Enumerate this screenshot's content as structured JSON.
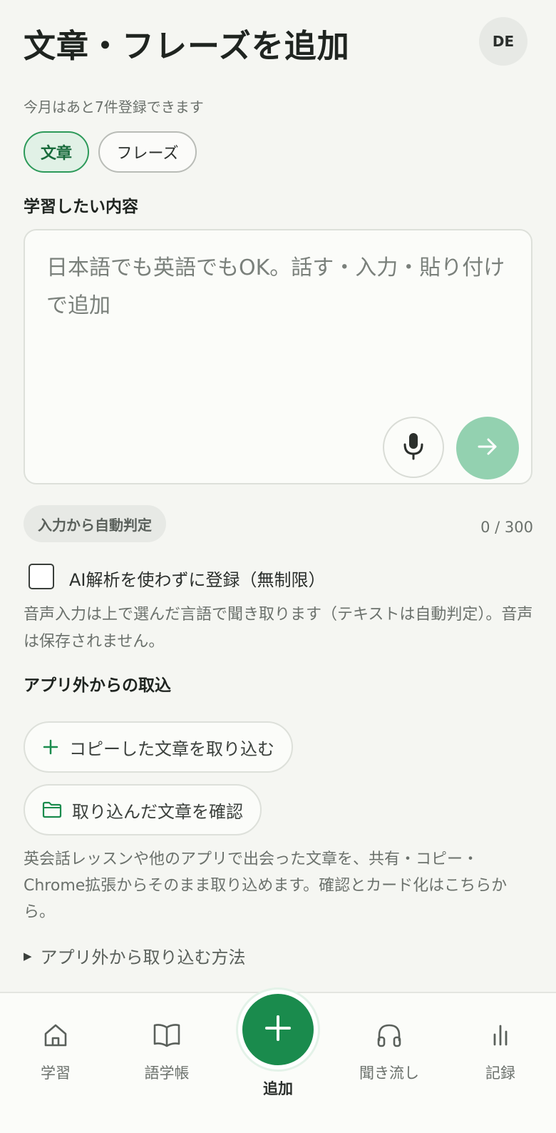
{
  "header": {
    "title": "文章・フレーズを追加",
    "avatar_initials": "DE"
  },
  "quota_text": "今月はあと7件登録できます",
  "type_chips": [
    {
      "label": "文章",
      "selected": true
    },
    {
      "label": "フレーズ",
      "selected": false
    }
  ],
  "content_section": {
    "label": "学習したい内容",
    "placeholder": "日本語でも英語でもOK。話す・入力・貼り付けで追加",
    "value": "",
    "mic_icon": "mic-icon",
    "send_icon": "arrow-right-icon"
  },
  "language_badge": "入力から自動判定",
  "char_counter": "0 / 300",
  "no_ai_option": {
    "label": "AI解析を使わずに登録（無制限）",
    "checked": false
  },
  "voice_note": "音声入力は上で選んだ言語で聞き取ります（テキストは自動判定）。音声は保存されません。",
  "import_section": {
    "title": "アプリ外からの取込",
    "import_button": "コピーした文章を取り込む",
    "review_button": "取り込んだ文章を確認",
    "description": "英会話レッスンや他のアプリで出会った文章を、共有・コピー・Chrome拡張からそのまま取り込めます。確認とカード化はこちらから。",
    "howto_label": "アプリ外から取り込む方法"
  },
  "colors": {
    "accent": "#1a8b4d",
    "accent_light": "#93d1b0",
    "background": "#f5f6f2"
  },
  "bottom_nav": {
    "items": [
      {
        "label": "学習",
        "icon": "home-icon"
      },
      {
        "label": "語学帳",
        "icon": "book-icon"
      },
      {
        "label": "追加",
        "icon": "plus-icon",
        "active": true
      },
      {
        "label": "聞き流し",
        "icon": "headphones-icon"
      },
      {
        "label": "記録",
        "icon": "bar-chart-icon"
      }
    ]
  }
}
